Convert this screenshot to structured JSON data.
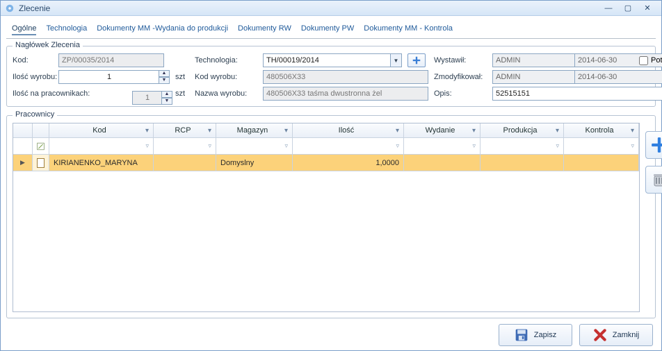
{
  "window": {
    "title": "Zlecenie"
  },
  "tabs": {
    "items": [
      {
        "label": "Ogólne"
      },
      {
        "label": "Technologia"
      },
      {
        "label": "Dokumenty MM -Wydania do produkcji"
      },
      {
        "label": "Dokumenty RW"
      },
      {
        "label": "Dokumenty PW"
      },
      {
        "label": "Dokumenty MM - Kontrola"
      }
    ]
  },
  "header": {
    "legend": "Nagłówek Zlecenia",
    "labels": {
      "kod": "Kod:",
      "ilosc_wyrobu": "Ilość wyrobu:",
      "ilosc_na_pracownikach": "Ilość na pracownikach:",
      "technologia": "Technologia:",
      "kod_wyrobu": "Kod wyrobu:",
      "nazwa_wyrobu": "Nazwa wyrobu:",
      "wystawil": "Wystawił:",
      "zmodyfikowal": "Zmodyfikował:",
      "opis": "Opis:",
      "potwierdzony": "Potwierdzony"
    },
    "values": {
      "kod": "ZP/00035/2014",
      "ilosc_wyrobu": "1",
      "ilosc_na_pracownikach": "1",
      "szt1": "szt",
      "szt2": "szt",
      "technologia": "TH/00019/2014",
      "kod_wyrobu": "480506X33",
      "nazwa_wyrobu": "480506X33 taśma dwustronna żel",
      "wystawil_user": "ADMIN",
      "wystawil_date": "2014-06-30",
      "zmodyfikowal_user": "ADMIN",
      "zmodyfikowal_date": "2014-06-30",
      "opis": "52515151"
    }
  },
  "workers": {
    "legend": "Pracownicy",
    "columns": {
      "kod": "Kod",
      "rcp": "RCP",
      "magazyn": "Magazyn",
      "ilosc": "Ilość",
      "wydanie": "Wydanie",
      "produkcja": "Produkcja",
      "kontrola": "Kontrola"
    },
    "rows": [
      {
        "kod": "KIRIANENKO_MARYNA",
        "rcp": "",
        "magazyn": "Domyslny",
        "ilosc": "1,0000",
        "wydanie": "",
        "produkcja": "",
        "kontrola": ""
      }
    ]
  },
  "footer": {
    "save": "Zapisz",
    "close": "Zamknij"
  }
}
